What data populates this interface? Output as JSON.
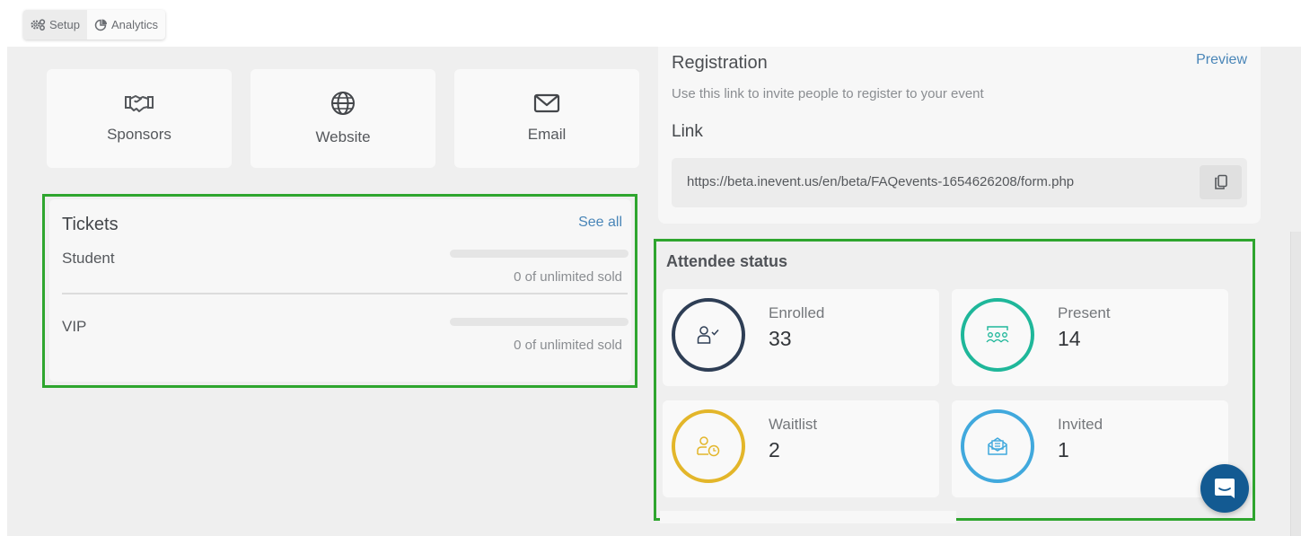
{
  "tabs": [
    {
      "label": "Setup",
      "icon": "gears-icon",
      "active": true
    },
    {
      "label": "Analytics",
      "icon": "pie-chart-icon",
      "active": false
    }
  ],
  "tiles": [
    {
      "label": "Sponsors",
      "icon": "handshake-icon"
    },
    {
      "label": "Website",
      "icon": "globe-icon"
    },
    {
      "label": "Email",
      "icon": "envelope-icon"
    }
  ],
  "tickets": {
    "title": "Tickets",
    "see_all": "See all",
    "items": [
      {
        "name": "Student",
        "sold_text": "0 of unlimited sold",
        "progress": 0
      },
      {
        "name": "VIP",
        "sold_text": "0 of unlimited sold",
        "progress": 0
      }
    ]
  },
  "registration": {
    "title": "Registration",
    "preview": "Preview",
    "description": "Use this link to invite people to register to your event",
    "link_label": "Link",
    "url": "https://beta.inevent.us/en/beta/FAQevents-1654626208/form.php",
    "copy_icon": "copy-icon"
  },
  "attendee_status": {
    "title": "Attendee status",
    "items": [
      {
        "label": "Enrolled",
        "value": "33",
        "color": "#2e3e55",
        "icon": "user-check-icon"
      },
      {
        "label": "Present",
        "value": "14",
        "color": "#1fb79a",
        "icon": "audience-icon"
      },
      {
        "label": "Waitlist",
        "value": "2",
        "color": "#e3b62a",
        "icon": "user-clock-icon"
      },
      {
        "label": "Invited",
        "value": "1",
        "color": "#41a9dd",
        "icon": "open-envelope-icon"
      }
    ]
  },
  "colors": {
    "accent_link": "#4a86b8",
    "highlight_border": "#2ea52e",
    "chat_button": "#135a92"
  },
  "chat": {
    "icon": "chat-icon"
  }
}
